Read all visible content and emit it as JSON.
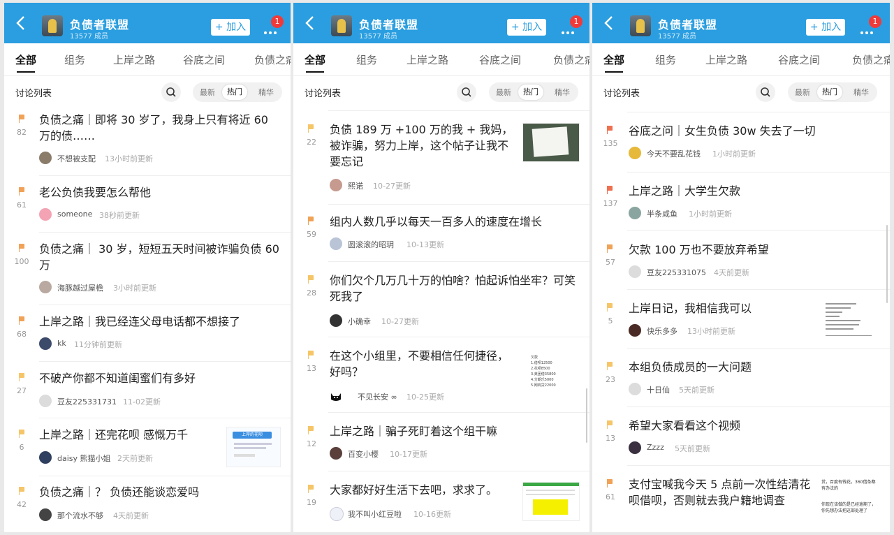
{
  "group": {
    "name": "负债者联盟",
    "members": "13577 成员",
    "join": "+ 加入",
    "badge": "1"
  },
  "tabs": [
    "全部",
    "组务",
    "上岸之路",
    "谷底之间",
    "负债之痛"
  ],
  "subbar": {
    "label": "讨论列表",
    "sort_options": [
      "最新",
      "热门",
      "精华"
    ]
  },
  "colors": {
    "header": "#2a9ee0",
    "flag_orange": "#f0a257",
    "flag_yellow": "#f5c568",
    "flag_red": "#ef7050"
  },
  "panels": [
    {
      "posts": [
        {
          "count": "82",
          "title": "负债之痛｜即将 30 岁了，我身上只有将近 60 万的债……",
          "author": "不想被支配",
          "time": "13小时前更新"
        },
        {
          "count": "61",
          "title": "老公负债我要怎么帮他",
          "author": "someone",
          "time": "38秒前更新"
        },
        {
          "count": "100",
          "title": "负债之痛｜ 30 岁，短短五天时间被诈骗负债 60 万",
          "author": "海豚越过屋檐",
          "time": "3小时前更新"
        },
        {
          "count": "68",
          "title": "上岸之路｜我已经连父母电话都不想接了",
          "author": "kk",
          "time": "11分钟前更新"
        },
        {
          "count": "27",
          "title": "不破产你都不知道闺蜜们有多好",
          "author": "豆友225331731",
          "time": "11-02更新"
        },
        {
          "count": "6",
          "title": "上岸之路｜还完花呗 感慨万千",
          "author": "daisy 熊猫小姐",
          "time": "2天前更新"
        },
        {
          "count": "42",
          "title": "负债之痛｜？ 负债还能谈恋爱吗",
          "author": "那个流水不够",
          "time": "4天前更新"
        }
      ]
    },
    {
      "posts": [
        {
          "count": "22",
          "title": "负债 189 万 +100 万的我 + 我妈，被诈骗，努力上岸，这个帖子让我不要忘记",
          "author": "熙诺",
          "time": "10-27更新"
        },
        {
          "count": "59",
          "title": "组内人数几乎以每天一百多人的速度在增长",
          "author": "圆滚滚的昭玥",
          "time": "10-13更新"
        },
        {
          "count": "28",
          "title": "你们欠个几万几十万的怕啥？怕起诉怕坐牢？可笑死我了",
          "author": "小确幸",
          "time": "10-27更新"
        },
        {
          "count": "13",
          "title": "在这个小组里，不要相信任何捷径，好吗？",
          "author": "不见长安 ∞",
          "time": "10-25更新"
        },
        {
          "count": "12",
          "title": "上岸之路｜骗子死盯着这个组干嘛",
          "author": "百变小樱",
          "time": "10-17更新"
        },
        {
          "count": "19",
          "title": "大家都好好生活下去吧，求求了。",
          "author": "我不叫小红豆啦",
          "time": "10-16更新"
        }
      ]
    },
    {
      "posts": [
        {
          "count": "135",
          "title": "谷底之问｜女生负债 30w 失去了一切",
          "author": "今天不要乱花钱",
          "time": "1小时前更新"
        },
        {
          "count": "137",
          "title": "上岸之路｜大学生欠款",
          "author": "半条咸鱼",
          "time": "1小时前更新"
        },
        {
          "count": "57",
          "title": "欠款 100 万也不要放弃希望",
          "author": "豆友225331075",
          "time": "4天前更新"
        },
        {
          "count": "5",
          "title": "上岸日记，我相信我可以",
          "author": "快乐多多",
          "time": "13小时前更新"
        },
        {
          "count": "23",
          "title": "本组负债成员的一大问题",
          "author": "十日仙",
          "time": "5天前更新"
        },
        {
          "count": "13",
          "title": "希望大家看看这个视频",
          "author": "Zzzz",
          "time": "5天前更新"
        },
        {
          "count": "61",
          "title": "支付宝喊我今天 5 点前一次性结清花呗借呗，否则就去我户籍地调查",
          "author": "",
          "time": ""
        }
      ]
    }
  ],
  "thumb_texts": {
    "p1_chat": "上岸的花呗",
    "p2_list": [
      "欠款",
      "1.借呗12500",
      "2.花呗8500",
      "3.美团借35800",
      "4.分期乐5000",
      "5.网商贷22000"
    ],
    "p3_note": [
      "贷，百度有钱花，360借条都有办法的",
      "你现在该做的是已经逾期了，你先想办法把这部处理了"
    ]
  }
}
